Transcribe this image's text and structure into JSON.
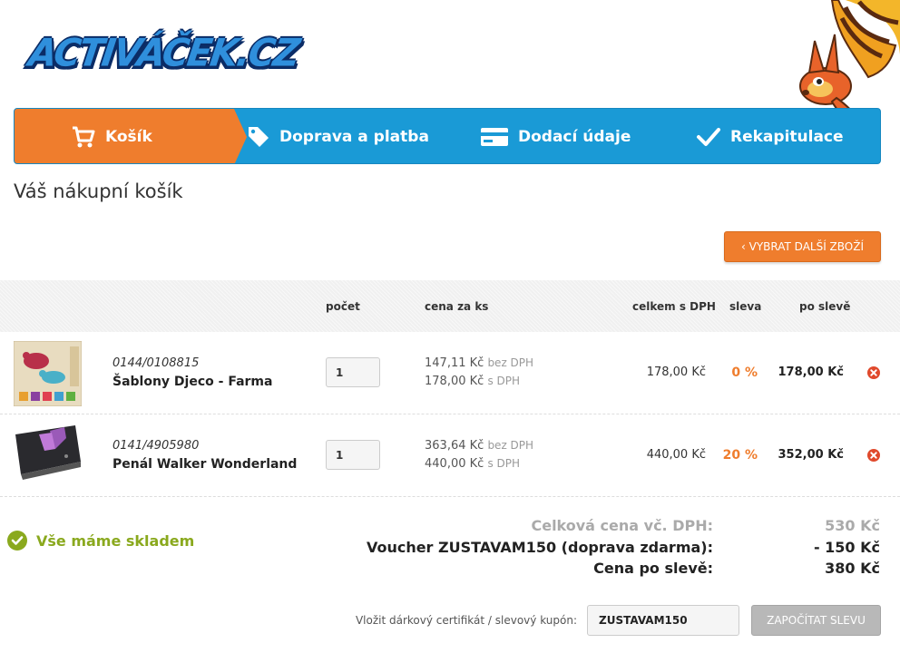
{
  "header": {
    "logo_text": "ACTIVÁČEK.CZ"
  },
  "steps": [
    {
      "label": "Košík",
      "icon": "cart-icon",
      "active": true
    },
    {
      "label": "Doprava a platba",
      "icon": "tag-icon",
      "active": false
    },
    {
      "label": "Dodací údaje",
      "icon": "card-icon",
      "active": false
    },
    {
      "label": "Rekapitulace",
      "icon": "check-icon",
      "active": false
    }
  ],
  "page_title": "Váš nákupní košík",
  "continue_button": "‹ VYBRAT DALŠÍ ZBOŽÍ",
  "table": {
    "headers": {
      "qty": "počet",
      "unit_price": "cena za ks",
      "total": "celkem s DPH",
      "discount": "sleva",
      "after_discount": "po slevě"
    },
    "rows": [
      {
        "code": "0144/0108815",
        "name": "Šablony Djeco - Farma",
        "qty": "1",
        "price_ex_vat": "147,11 Kč",
        "price_ex_vat_note": "bez DPH",
        "price_inc_vat": "178,00 Kč",
        "price_inc_vat_note": "s DPH",
        "total": "178,00 Kč",
        "discount": "0 %",
        "after_discount": "178,00 Kč"
      },
      {
        "code": "0141/4905980",
        "name": "Penál Walker Wonderland",
        "qty": "1",
        "price_ex_vat": "363,64 Kč",
        "price_ex_vat_note": "bez DPH",
        "price_inc_vat": "440,00 Kč",
        "price_inc_vat_note": "s DPH",
        "total": "440,00 Kč",
        "discount": "20 %",
        "after_discount": "352,00 Kč"
      }
    ]
  },
  "stock_status": "Vše máme skladem",
  "summary": {
    "total_label": "Celková cena vč. DPH:",
    "total_value": "530 Kč",
    "voucher_label": "Voucher ZUSTAVAM150 (doprava zdarma):",
    "voucher_value": "- 150 Kč",
    "final_label": "Cena po slevě:",
    "final_value": "380 Kč"
  },
  "coupon": {
    "label": "Vložit dárkový certifikát / slevový kupón:",
    "value": "ZUSTAVAM150",
    "button": "ZAPOČÍTAT SLEVU"
  },
  "colors": {
    "primary_blue": "#1a9ad6",
    "accent_orange": "#ef7d2d",
    "stock_green": "#8aa91e",
    "remove_red": "#e0492c"
  }
}
